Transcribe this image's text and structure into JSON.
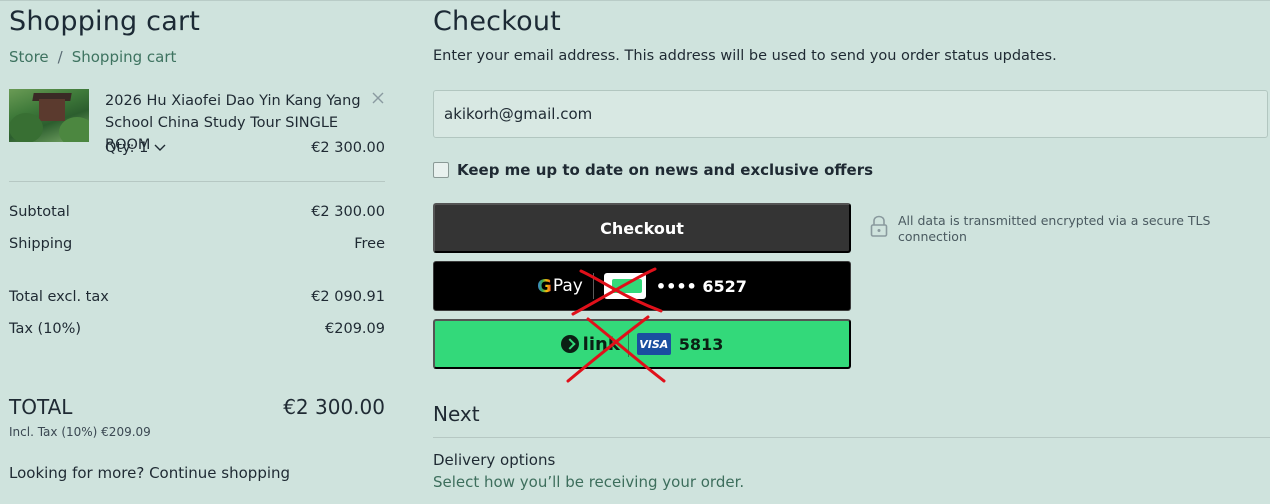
{
  "cart": {
    "title": "Shopping cart",
    "breadcrumb": [
      "Store",
      "Shopping cart"
    ],
    "breadcrumb_sep": "/",
    "item": {
      "title": "2026 Hu Xiaofei Dao Yin Kang Yang School China Study Tour SINGLE ROOM",
      "qty_label": "Qty: 1",
      "price": "€2 300.00"
    },
    "summary": {
      "subtotal_label": "Subtotal",
      "subtotal_value": "€2 300.00",
      "shipping_label": "Shipping",
      "shipping_value": "Free",
      "excl_label": "Total excl. tax",
      "excl_value": "€2 090.91",
      "tax_label": "Tax (10%)",
      "tax_value": "€209.09"
    },
    "total_label": "TOTAL",
    "total_value": "€2 300.00",
    "incl_tax": "Incl. Tax (10%) €209.09",
    "continue": "Looking for more? Continue shopping"
  },
  "checkout": {
    "title": "Checkout",
    "description": "Enter your email address. This address will be used to send you order status updates.",
    "email_value": "akikorh@gmail.com",
    "newsletter_label": "Keep me up to date on news and exclusive offers",
    "checkout_button": "Checkout",
    "gpay": {
      "logo": "Pay",
      "card_digits": "•••• 6527"
    },
    "link": {
      "logo": "link",
      "card_brand": "VISA",
      "card_digits": "5813"
    },
    "secure_text": "All data is transmitted encrypted via a secure TLS connection",
    "next_title": "Next",
    "delivery_title": "Delivery options",
    "delivery_sub": "Select how you’ll be receiving your order."
  }
}
